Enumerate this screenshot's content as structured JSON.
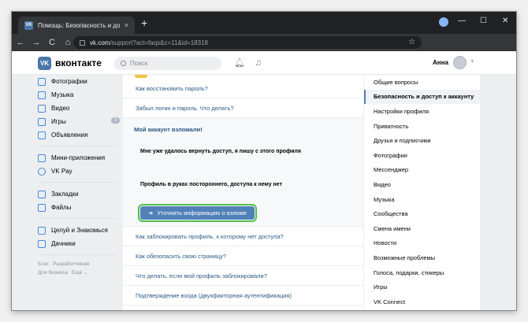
{
  "browser": {
    "tab_title": "Помощь: Безопасность и досту",
    "tab_close": "×",
    "new_tab": "+",
    "url_host": "vk.com",
    "url_path": "/support?act=faqs&c=11&id=18318",
    "nav_back": "←",
    "nav_forward": "→",
    "nav_reload": "C",
    "nav_home": "⌂",
    "window_min": "—",
    "window_max": "☐",
    "window_close": "✕",
    "star": "☆"
  },
  "header": {
    "logo_text": "VK",
    "site_name": "вконтакте",
    "search_placeholder": "Поиск",
    "user_name": "Анна"
  },
  "left_menu": {
    "items": [
      {
        "label": "Фотографии",
        "icon": "photo-icon"
      },
      {
        "label": "Музыка",
        "icon": "music-icon"
      },
      {
        "label": "Видео",
        "icon": "video-icon"
      },
      {
        "label": "Игры",
        "icon": "games-icon",
        "counter": "3"
      },
      {
        "label": "Объявления",
        "icon": "ads-icon"
      },
      {
        "label": "Мини-приложения",
        "icon": "apps-icon"
      },
      {
        "label": "VK Pay",
        "icon": "vkpay-icon"
      },
      {
        "label": "Закладки",
        "icon": "bookmarks-icon"
      },
      {
        "label": "Файлы",
        "icon": "files-icon"
      },
      {
        "label": "Целуй и Знакомься",
        "icon": "app-icon"
      },
      {
        "label": "Дачники",
        "icon": "app-icon"
      }
    ],
    "footer": [
      "Блог",
      "Разработчикам",
      "Для бизнеса",
      "Ещё ⌄"
    ]
  },
  "content": {
    "questions_top": [
      "Как восстановить пароль?",
      "Забыл логин и пароль. Что делать?"
    ],
    "expanded": {
      "title": "Мой аккаунт взломали!",
      "items": [
        "Мне уже удалось вернуть доступ, я пишу с этого профиля",
        "Профиль в руках постороннего, доступа к нему нет"
      ],
      "button": "Уточнить информацию о взломе",
      "button_arrow": "➔"
    },
    "questions_bottom": [
      "Как заблокировать профиль, к которому нет доступа?",
      "Как обезопасить свою страницу?",
      "Что делать, если мой профиль заблокировали?",
      "Подтверждение входа (двухфакторная аутентификация)"
    ]
  },
  "right_menu": {
    "items": [
      "Общие вопросы",
      "Безопасность и доступ к аккаунту",
      "Настройки профиля",
      "Приватность",
      "Друзья и подписчики",
      "Фотографии",
      "Мессенджер",
      "Видео",
      "Музыка",
      "Сообщества",
      "Смена имени",
      "Новости",
      "Возможные проблемы",
      "Голоса, подарки, стикеры",
      "Игры",
      "VK Connect"
    ],
    "active_index": 1
  }
}
